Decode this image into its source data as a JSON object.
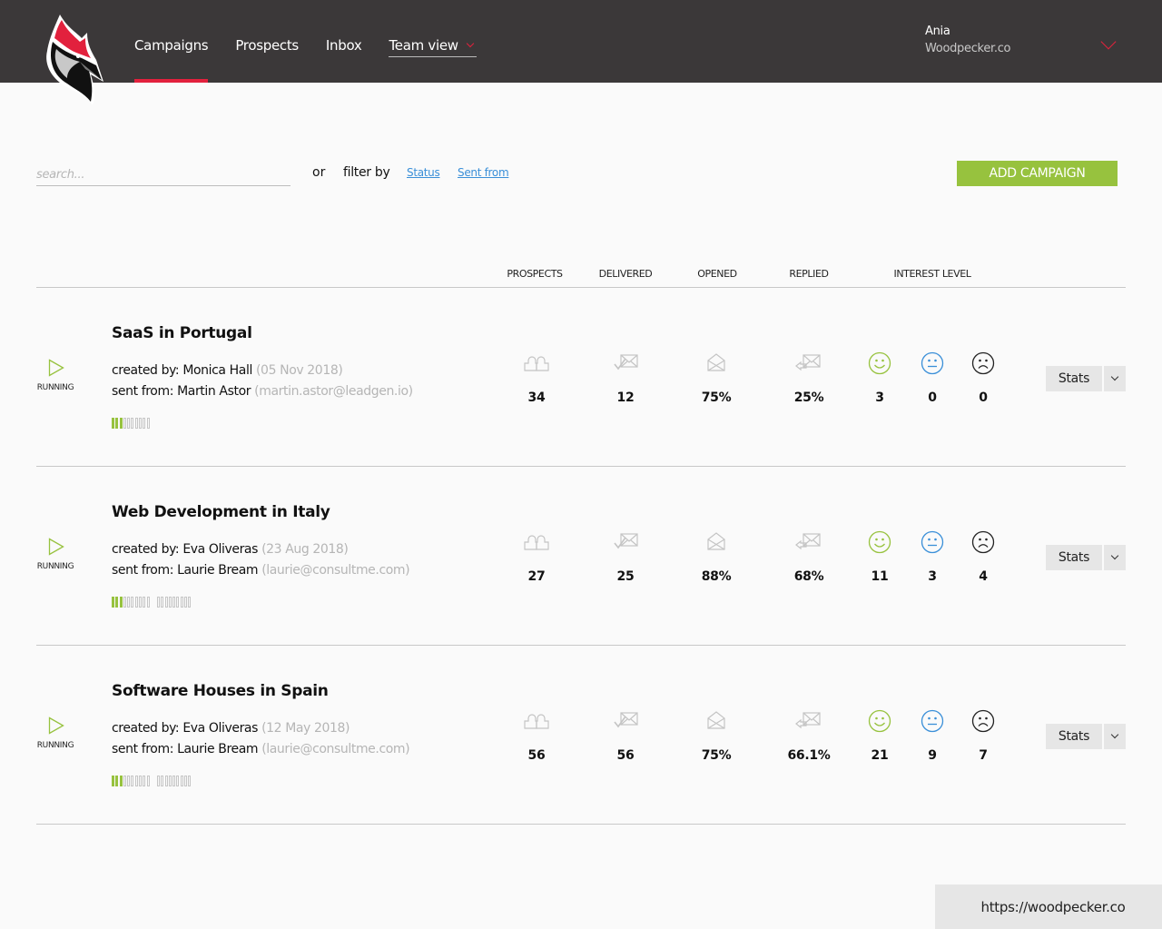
{
  "nav": {
    "items": [
      {
        "label": "Campaigns",
        "active": true
      },
      {
        "label": "Prospects",
        "active": false
      },
      {
        "label": "Inbox",
        "active": false
      }
    ],
    "team_view": "Team view"
  },
  "user": {
    "name": "Ania",
    "org": "Woodpecker.co"
  },
  "toolbar": {
    "search_placeholder": "search...",
    "search_value": "",
    "or": "or",
    "filter_by": "filter by",
    "filter_status": "Status",
    "filter_sent_from": "Sent from",
    "add_campaign": "ADD CAMPAIGN"
  },
  "columns": {
    "prospects": "PROSPECTS",
    "delivered": "DELIVERED",
    "opened": "OPENED",
    "replied": "REPLIED",
    "interest": "INTEREST LEVEL"
  },
  "colors": {
    "brand_red": "#e2213d",
    "accent_green": "#97c23e",
    "link_blue": "#3a8fd8",
    "neutral_blue": "#3a8fd8"
  },
  "campaigns": [
    {
      "title": "SaaS in Portugal",
      "status": "RUNNING",
      "created_label": "created by:",
      "created_by": "Monica Hall",
      "created_date": "(05 Nov 2018)",
      "sent_label": "sent from:",
      "sent_from": "Martin Astor",
      "sent_email": "(martin.astor@leadgen.io)",
      "steps": [
        {
          "done": 3,
          "total": 10
        }
      ],
      "prospects": "34",
      "delivered": "12",
      "opened": "75%",
      "replied": "25%",
      "interested": "3",
      "maybe": "0",
      "not_interested": "0",
      "stats_label": "Stats"
    },
    {
      "title": "Web Development in Italy",
      "status": "RUNNING",
      "created_label": "created by:",
      "created_by": "Eva Oliveras",
      "created_date": "(23 Aug 2018)",
      "sent_label": "sent from:",
      "sent_from": "Laurie Bream",
      "sent_email": "(laurie@consultme.com)",
      "steps": [
        {
          "done": 3,
          "total": 10
        },
        {
          "done": 0,
          "total": 9
        }
      ],
      "prospects": "27",
      "delivered": "25",
      "opened": "88%",
      "replied": "68%",
      "interested": "11",
      "maybe": "3",
      "not_interested": "4",
      "stats_label": "Stats"
    },
    {
      "title": "Software Houses in Spain",
      "status": "RUNNING",
      "created_label": "created by:",
      "created_by": "Eva Oliveras",
      "created_date": "(12 May 2018)",
      "sent_label": "sent from:",
      "sent_from": "Laurie Bream",
      "sent_email": "(laurie@consultme.com)",
      "steps": [
        {
          "done": 3,
          "total": 10
        },
        {
          "done": 0,
          "total": 9
        }
      ],
      "prospects": "56",
      "delivered": "56",
      "opened": "75%",
      "replied": "66.1%",
      "interested": "21",
      "maybe": "9",
      "not_interested": "7",
      "stats_label": "Stats"
    }
  ],
  "footer": {
    "url": "https://woodpecker.co"
  }
}
